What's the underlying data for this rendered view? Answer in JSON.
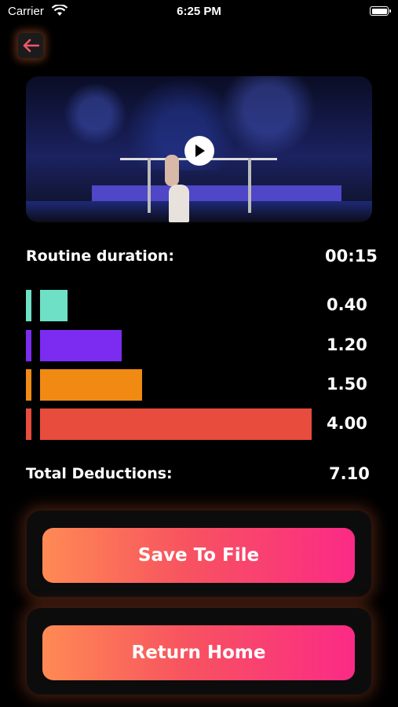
{
  "status_bar": {
    "carrier": "Carrier",
    "time": "6:25 PM"
  },
  "video": {
    "thumbnail": "gymnastics-parallel-bars-frame",
    "play_icon": "play-icon"
  },
  "routine": {
    "label": "Routine duration:",
    "value": "00:15"
  },
  "deductions": [
    {
      "value": "0.40",
      "color": "#6ee0c6",
      "fraction": 0.1
    },
    {
      "value": "1.20",
      "color": "#7b2cf0",
      "fraction": 0.3
    },
    {
      "value": "1.50",
      "color": "#f08a12",
      "fraction": 0.375
    },
    {
      "value": "4.00",
      "color": "#e74c3c",
      "fraction": 1.0
    }
  ],
  "total": {
    "label": "Total Deductions:",
    "value": "7.10"
  },
  "buttons": {
    "save": "Save To File",
    "home": "Return Home"
  },
  "colors": {
    "accent_start": "#ff8a54",
    "accent_end": "#fb2a86",
    "back_arrow": "#f0566b"
  }
}
